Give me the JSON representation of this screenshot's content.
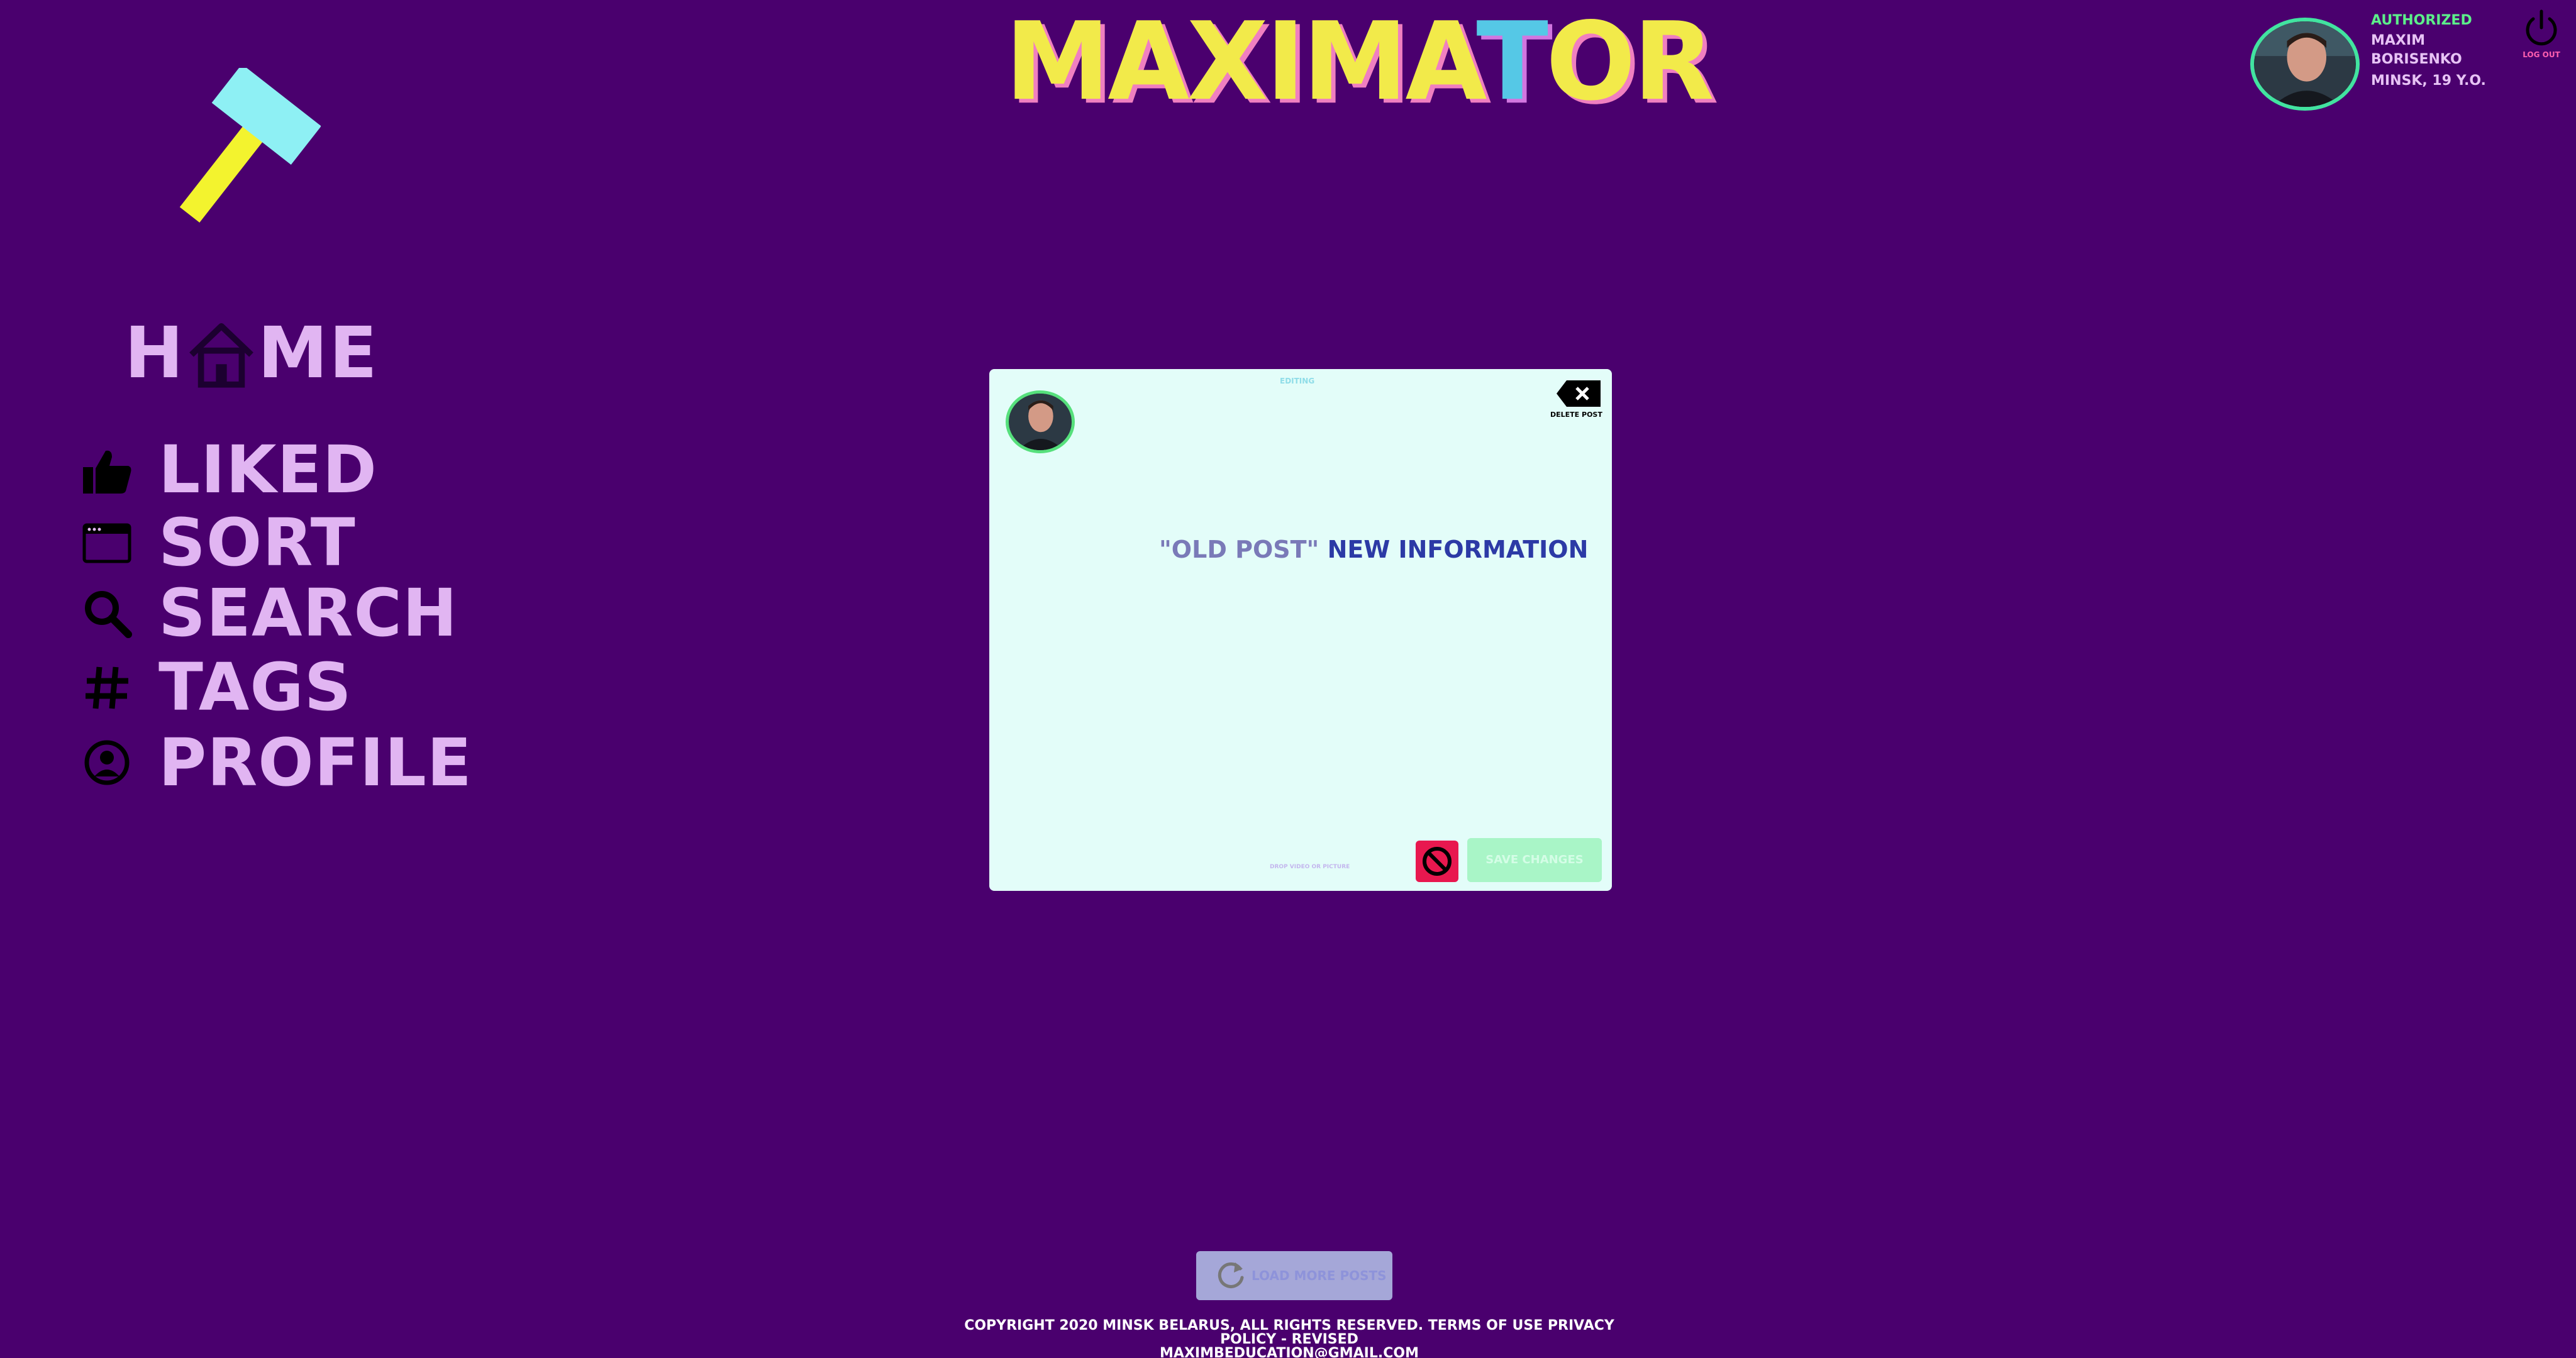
{
  "logo": {
    "text_a": "MAXIMA",
    "text_t": "T",
    "text_b": "OR"
  },
  "nav": {
    "home_h": "H",
    "home_me": "ME",
    "items": [
      {
        "label": "LIKED",
        "icon": "thumbs-up-icon"
      },
      {
        "label": "SORT",
        "icon": "window-icon"
      },
      {
        "label": "SEARCH",
        "icon": "search-icon"
      },
      {
        "label": "TAGS",
        "icon": "hashtag-icon"
      },
      {
        "label": "PROFILE",
        "icon": "user-circle-icon"
      }
    ]
  },
  "user": {
    "status": "AUTHORIZED",
    "name_line1": "MAXIM",
    "name_line2": "BORISENKO",
    "location": "MINSK, 19 Y.O.",
    "logout_label": "LOG OUT"
  },
  "modal": {
    "editing_label": "EDITING",
    "delete_label": "DELETE POST",
    "old_text": "\"OLD POST\"",
    "new_text": "NEW INFORMATION",
    "drop_label": "DROP VIDEO OR PICTURE",
    "save_label": "SAVE CHANGES"
  },
  "load_more": {
    "label": "LOAD MORE POSTS"
  },
  "footer": {
    "line1": "COPYRIGHT 2020 MINSK BELARUS, ALL RIGHTS RESERVED. TERMS OF USE PRIVACY POLICY - REVISED",
    "line2": "MAXIMBEDUCATION@GMAIL.COM"
  },
  "colors": {
    "background": "#4a006e",
    "logo_yellow": "#f2ea4a",
    "modal_bg": "#e3fdf9",
    "accent_green": "#5cf08a",
    "cancel_red": "#e8184f",
    "save_green": "#a9f5c7"
  }
}
